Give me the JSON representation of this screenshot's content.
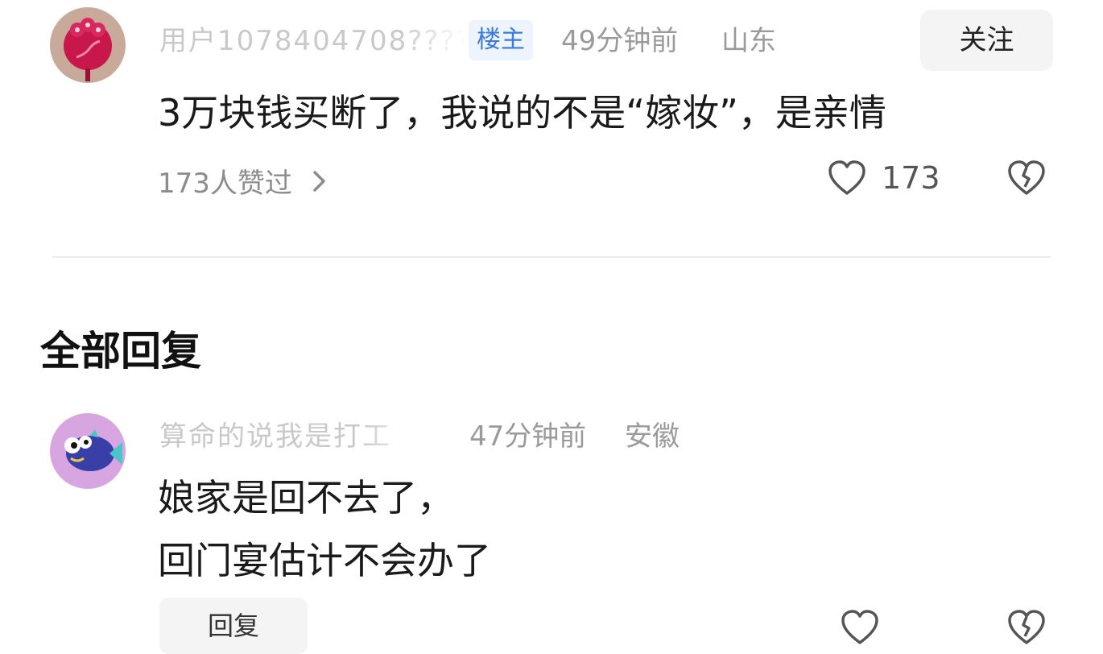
{
  "comment": {
    "username": "用户1078404708?????",
    "badge": "楼主",
    "time": "49分钟前",
    "location": "山东",
    "follow_label": "关注",
    "text": "3万块钱买断了，我说的不是“嫁妆”，是亲情",
    "likers_text": "173人赞过",
    "like_count": "173",
    "icons": [
      "avatar-flower",
      "heart-icon",
      "broken-heart-icon",
      "chevron-right-icon"
    ]
  },
  "section_title": "全部回复",
  "reply": {
    "username": "算命的说我是打工",
    "time": "47分钟前",
    "location": "安徽",
    "lines": [
      "娘家是回不去了，",
      "回门宴估计不会办了"
    ],
    "reply_label": "回复",
    "icons": [
      "avatar-fish",
      "heart-icon",
      "broken-heart-icon"
    ]
  },
  "colors": {
    "badge_bg": "#eef4fd",
    "badge_text": "#3a79d8",
    "meta": "#9a9a9a"
  }
}
